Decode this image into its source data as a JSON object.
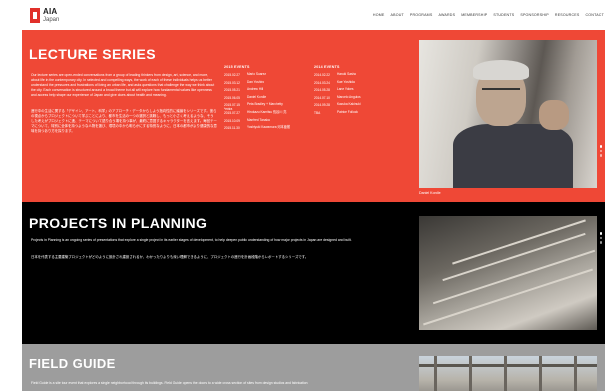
{
  "header": {
    "logo_title": "AIA",
    "logo_sub": "Japan",
    "nav": [
      "HOME",
      "ABOUT",
      "PROGRAMS",
      "AWARDS",
      "MEMBERSHIP",
      "STUDENTS",
      "SPONSORSHIP",
      "RESOURCES",
      "CONTACT"
    ]
  },
  "lecture": {
    "title": "LECTURE SERIES",
    "description": "Our lecture series are open-ended conversations from a group of leading thinkers from design, art, science, and more, about life in the contemporary city. In selected and compelling ways, the work of each of these individuals helps us better understand the pressures and frustrations of living an urban life, and asks questions that challenge the way we think about the city. Each conversation is structured around a broad theme but all will explore how fundamental values like openness and access help shape our experience of Japan and give clues about health and meaning.",
    "description_jp": "進行中の生活に関する「デザイン、アート、科学」のアプローチ・データからしよう指向性的に議論をシリーズです。彼らの視点からプロジェクトについて学ぶことにより、都市を生活の一つの選択と挑戦し、もっと小さく考えるような、そうした考えがプロジェクトに進、テーマについて語り合う場を持つ事が、最終に意図するキャラクターを言えます。毎回テーマについて、特別に全体を持つような人物を選び、環境の中から明らかにする特別なように、日本の都市がより健康的な意味を持つあり方を探ります。",
    "events_a_heading": "2015 EVENTS",
    "events_a": [
      {
        "date": "2015.02.27",
        "name": "Mario Suarez"
      },
      {
        "date": "2015.03.12",
        "name": "Dan Yoshiro"
      },
      {
        "date": "2015.05.21",
        "name": "Andrew Hill"
      },
      {
        "date": "2015.06.05",
        "name": "Daniel Kordle"
      },
      {
        "date": "2015.07.15 *extra",
        "name": "Peta Bradley + Marchetty"
      },
      {
        "date": "2015.07.27",
        "name": "Hirokazu Kamitsu 長谷川 亮"
      },
      {
        "date": "2015.10.09",
        "name": "Manfred Tanaka"
      },
      {
        "date": "2015.11.30",
        "name": "Yoshiyuki Kawamura 河本亜樹"
      }
    ],
    "events_b_heading": "2014 EVENTS",
    "events_b": [
      {
        "date": "2014.02.22",
        "name": "Haruki Sasho"
      },
      {
        "date": "2014.03.24",
        "name": "Kae Yoshida"
      },
      {
        "date": "2014.05.28",
        "name": "Lane Yokes"
      },
      {
        "date": "2014.07.10",
        "name": "Marcelo Angulos"
      },
      {
        "date": "2014.09.28",
        "name": "Kazuka Kakinuki"
      },
      {
        "date": "TBA",
        "name": "Patrice Follock"
      }
    ],
    "photo_caption": "Daniel Kordle"
  },
  "projects": {
    "title": "PROJECTS IN PLANNING",
    "description": "Projects in Planning is an ongoing series of presentations that explore a single project in its earlier stages of development, to help deepen public understanding of how major projects in Japan are designed and built.",
    "description_jp": "日本を代表する主要建築プロジェクトがどのように設計され建設されるか、わかったりよりも深い理解できるように、プロジェクトの進行を計画段階からレポートするシリーズです。"
  },
  "field": {
    "title": "FIELD GUIDE",
    "description": "Field Guide is a site tour event that explores a single neighborhood through its buildings. Field Guide opens the doors to a wide cross section of sites from design studios and fabrication"
  },
  "colors": {
    "lecture_bg": "#ef4836",
    "projects_bg": "#000000",
    "field_bg": "#9d9d9d",
    "logo_red": "#e1302a"
  }
}
